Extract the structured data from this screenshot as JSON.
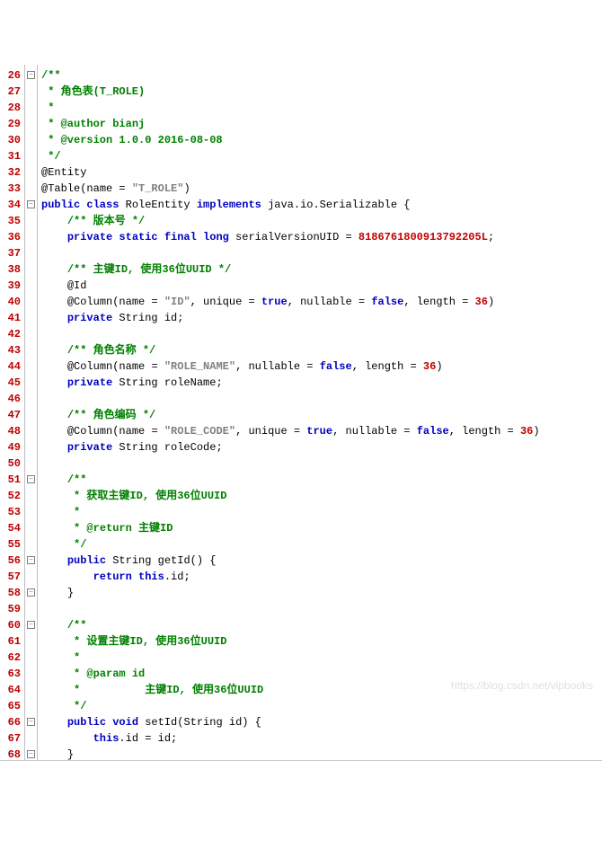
{
  "lines": [
    {
      "n": "26",
      "fold": "minus",
      "segs": [
        {
          "c": "comment",
          "t": "/**"
        }
      ]
    },
    {
      "n": "27",
      "fold": "",
      "segs": [
        {
          "c": "comment",
          "t": " * 角色表(T_ROLE)"
        }
      ]
    },
    {
      "n": "28",
      "fold": "",
      "segs": [
        {
          "c": "comment",
          "t": " *"
        }
      ]
    },
    {
      "n": "29",
      "fold": "",
      "segs": [
        {
          "c": "comment",
          "t": " * @author bianj"
        }
      ]
    },
    {
      "n": "30",
      "fold": "",
      "segs": [
        {
          "c": "comment",
          "t": " * @version 1.0.0 2016-08-08"
        }
      ]
    },
    {
      "n": "31",
      "fold": "",
      "segs": [
        {
          "c": "comment",
          "t": " */"
        }
      ]
    },
    {
      "n": "32",
      "fold": "",
      "segs": [
        {
          "c": "ann",
          "t": "@Entity"
        }
      ]
    },
    {
      "n": "33",
      "fold": "",
      "segs": [
        {
          "c": "ann",
          "t": "@Table"
        },
        {
          "c": "op",
          "t": "(name = "
        },
        {
          "c": "str",
          "t": "\"T_ROLE\""
        },
        {
          "c": "op",
          "t": ")"
        }
      ]
    },
    {
      "n": "34",
      "fold": "minus",
      "segs": [
        {
          "c": "kw",
          "t": "public class "
        },
        {
          "c": "black",
          "t": "RoleEntity "
        },
        {
          "c": "kw",
          "t": "implements "
        },
        {
          "c": "black",
          "t": "java.io.Serializable "
        },
        {
          "c": "op",
          "t": "{"
        }
      ]
    },
    {
      "n": "35",
      "fold": "",
      "indent": "    ",
      "segs": [
        {
          "c": "comment",
          "t": "/** 版本号 */"
        }
      ]
    },
    {
      "n": "36",
      "fold": "",
      "indent": "    ",
      "segs": [
        {
          "c": "kw",
          "t": "private static final long "
        },
        {
          "c": "black",
          "t": "serialVersionUID "
        },
        {
          "c": "op",
          "t": "= "
        },
        {
          "c": "num",
          "t": "8186761800913792205L"
        },
        {
          "c": "op",
          "t": ";"
        }
      ]
    },
    {
      "n": "37",
      "fold": "",
      "segs": []
    },
    {
      "n": "38",
      "fold": "",
      "indent": "    ",
      "segs": [
        {
          "c": "comment",
          "t": "/** 主键ID, 使用36位UUID */"
        }
      ]
    },
    {
      "n": "39",
      "fold": "",
      "indent": "    ",
      "segs": [
        {
          "c": "ann",
          "t": "@Id"
        }
      ]
    },
    {
      "n": "40",
      "fold": "",
      "indent": "    ",
      "segs": [
        {
          "c": "ann",
          "t": "@Column"
        },
        {
          "c": "op",
          "t": "(name = "
        },
        {
          "c": "str",
          "t": "\"ID\""
        },
        {
          "c": "op",
          "t": ", unique = "
        },
        {
          "c": "kw",
          "t": "true"
        },
        {
          "c": "op",
          "t": ", nullable = "
        },
        {
          "c": "kw",
          "t": "false"
        },
        {
          "c": "op",
          "t": ", length = "
        },
        {
          "c": "num",
          "t": "36"
        },
        {
          "c": "op",
          "t": ")"
        }
      ]
    },
    {
      "n": "41",
      "fold": "",
      "indent": "    ",
      "segs": [
        {
          "c": "kw",
          "t": "private "
        },
        {
          "c": "black",
          "t": "String id"
        },
        {
          "c": "op",
          "t": ";"
        }
      ]
    },
    {
      "n": "42",
      "fold": "",
      "segs": []
    },
    {
      "n": "43",
      "fold": "",
      "indent": "    ",
      "segs": [
        {
          "c": "comment",
          "t": "/** 角色名称 */"
        }
      ]
    },
    {
      "n": "44",
      "fold": "",
      "indent": "    ",
      "segs": [
        {
          "c": "ann",
          "t": "@Column"
        },
        {
          "c": "op",
          "t": "(name = "
        },
        {
          "c": "str",
          "t": "\"ROLE_NAME\""
        },
        {
          "c": "op",
          "t": ", nullable = "
        },
        {
          "c": "kw",
          "t": "false"
        },
        {
          "c": "op",
          "t": ", length = "
        },
        {
          "c": "num",
          "t": "36"
        },
        {
          "c": "op",
          "t": ")"
        }
      ]
    },
    {
      "n": "45",
      "fold": "",
      "indent": "    ",
      "segs": [
        {
          "c": "kw",
          "t": "private "
        },
        {
          "c": "black",
          "t": "String roleName"
        },
        {
          "c": "op",
          "t": ";"
        }
      ]
    },
    {
      "n": "46",
      "fold": "",
      "segs": []
    },
    {
      "n": "47",
      "fold": "",
      "indent": "    ",
      "segs": [
        {
          "c": "comment",
          "t": "/** 角色编码 */"
        }
      ]
    },
    {
      "n": "48",
      "fold": "",
      "indent": "    ",
      "segs": [
        {
          "c": "ann",
          "t": "@Column"
        },
        {
          "c": "op",
          "t": "(name = "
        },
        {
          "c": "str",
          "t": "\"ROLE_CODE\""
        },
        {
          "c": "op",
          "t": ", unique = "
        },
        {
          "c": "kw",
          "t": "true"
        },
        {
          "c": "op",
          "t": ", nullable = "
        },
        {
          "c": "kw",
          "t": "false"
        },
        {
          "c": "op",
          "t": ", length = "
        },
        {
          "c": "num",
          "t": "36"
        },
        {
          "c": "op",
          "t": ")"
        }
      ]
    },
    {
      "n": "49",
      "fold": "",
      "indent": "    ",
      "segs": [
        {
          "c": "kw",
          "t": "private "
        },
        {
          "c": "black",
          "t": "String roleCode"
        },
        {
          "c": "op",
          "t": ";"
        }
      ]
    },
    {
      "n": "50",
      "fold": "",
      "segs": []
    },
    {
      "n": "51",
      "fold": "minus",
      "indent": "    ",
      "segs": [
        {
          "c": "comment",
          "t": "/**"
        }
      ]
    },
    {
      "n": "52",
      "fold": "",
      "indent": "    ",
      "segs": [
        {
          "c": "comment",
          "t": " * 获取主键ID, 使用36位UUID"
        }
      ]
    },
    {
      "n": "53",
      "fold": "",
      "indent": "    ",
      "segs": [
        {
          "c": "comment",
          "t": " *"
        }
      ]
    },
    {
      "n": "54",
      "fold": "",
      "indent": "    ",
      "segs": [
        {
          "c": "comment",
          "t": " * @return 主键ID"
        }
      ]
    },
    {
      "n": "55",
      "fold": "",
      "indent": "    ",
      "segs": [
        {
          "c": "comment",
          "t": " */"
        }
      ]
    },
    {
      "n": "56",
      "fold": "minus",
      "indent": "    ",
      "segs": [
        {
          "c": "kw",
          "t": "public "
        },
        {
          "c": "black",
          "t": "String getId"
        },
        {
          "c": "op",
          "t": "() {"
        }
      ]
    },
    {
      "n": "57",
      "fold": "",
      "indent": "        ",
      "segs": [
        {
          "c": "kw",
          "t": "return this"
        },
        {
          "c": "op",
          "t": "."
        },
        {
          "c": "black",
          "t": "id"
        },
        {
          "c": "op",
          "t": ";"
        }
      ]
    },
    {
      "n": "58",
      "fold": "minus",
      "indent": "    ",
      "segs": [
        {
          "c": "op",
          "t": "}"
        }
      ]
    },
    {
      "n": "59",
      "fold": "",
      "segs": []
    },
    {
      "n": "60",
      "fold": "minus",
      "indent": "    ",
      "segs": [
        {
          "c": "comment",
          "t": "/**"
        }
      ]
    },
    {
      "n": "61",
      "fold": "",
      "indent": "    ",
      "segs": [
        {
          "c": "comment",
          "t": " * 设置主键ID, 使用36位UUID"
        }
      ]
    },
    {
      "n": "62",
      "fold": "",
      "indent": "    ",
      "segs": [
        {
          "c": "comment",
          "t": " *"
        }
      ]
    },
    {
      "n": "63",
      "fold": "",
      "indent": "    ",
      "segs": [
        {
          "c": "comment",
          "t": " * @param id"
        }
      ]
    },
    {
      "n": "64",
      "fold": "",
      "indent": "    ",
      "segs": [
        {
          "c": "comment",
          "t": " *          主键ID, 使用36位UUID"
        }
      ]
    },
    {
      "n": "65",
      "fold": "",
      "indent": "    ",
      "segs": [
        {
          "c": "comment",
          "t": " */"
        }
      ]
    },
    {
      "n": "66",
      "fold": "minus",
      "indent": "    ",
      "segs": [
        {
          "c": "kw",
          "t": "public void "
        },
        {
          "c": "black",
          "t": "setId"
        },
        {
          "c": "op",
          "t": "("
        },
        {
          "c": "black",
          "t": "String id"
        },
        {
          "c": "op",
          "t": ") {"
        }
      ]
    },
    {
      "n": "67",
      "fold": "",
      "indent": "        ",
      "segs": [
        {
          "c": "kw",
          "t": "this"
        },
        {
          "c": "op",
          "t": "."
        },
        {
          "c": "black",
          "t": "id "
        },
        {
          "c": "op",
          "t": "= "
        },
        {
          "c": "black",
          "t": "id"
        },
        {
          "c": "op",
          "t": ";"
        }
      ]
    },
    {
      "n": "68",
      "fold": "minus",
      "indent": "    ",
      "segs": [
        {
          "c": "op",
          "t": "}"
        }
      ]
    }
  ],
  "watermark": "https://blog.csdn.net/vipbooks"
}
